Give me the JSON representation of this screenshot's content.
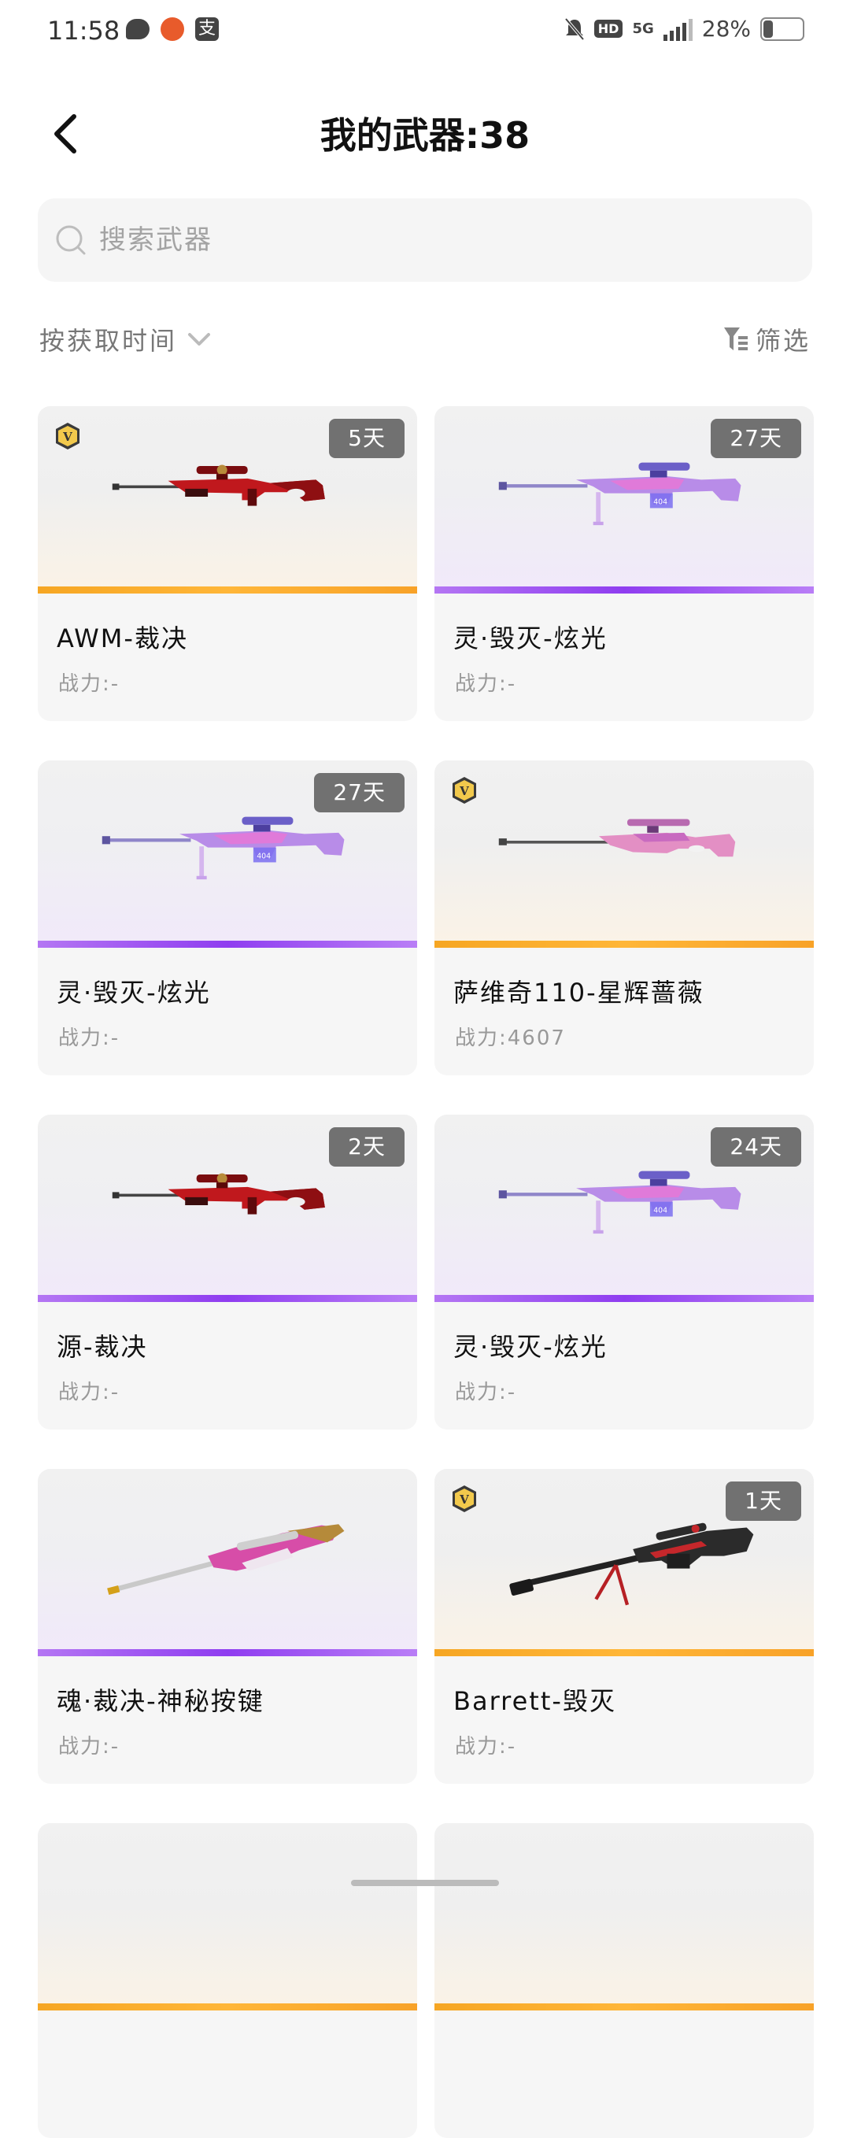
{
  "status_bar": {
    "time": "11:58",
    "zhi_icon": "支",
    "hd": "HD",
    "network": "5G",
    "battery": "28%",
    "battery_level": 0.28
  },
  "header": {
    "title": "我的武器:38",
    "back_icon": "chevron-left-icon"
  },
  "search": {
    "placeholder": "搜索武器",
    "icon": "search-icon"
  },
  "sort": {
    "label": "按获取时间",
    "icon": "chevron-down-icon"
  },
  "filter": {
    "label": "筛选",
    "icon": "filter-icon"
  },
  "colors": {
    "gold_bar": "#f6a623",
    "purple_bar": "#8f3df0",
    "tag_bg": "#5a5a5a"
  },
  "cards": [
    {
      "name": "AWM-裁决",
      "power": "战力:-",
      "days": "5天",
      "vip": true,
      "rarity": "gold",
      "gun": "red-sniper"
    },
    {
      "name": "灵·毁灭-炫光",
      "power": "战力:-",
      "days": "27天",
      "vip": false,
      "rarity": "purple",
      "gun": "purple-barrett"
    },
    {
      "name": "灵·毁灭-炫光",
      "power": "战力:-",
      "days": "27天",
      "vip": false,
      "rarity": "purple",
      "gun": "purple-barrett"
    },
    {
      "name": "萨维奇110-星辉蔷薇",
      "power": "战力:4607",
      "days": "",
      "vip": true,
      "rarity": "gold",
      "gun": "pink-sniper"
    },
    {
      "name": "源-裁决",
      "power": "战力:-",
      "days": "2天",
      "vip": false,
      "rarity": "purple",
      "gun": "red-sniper"
    },
    {
      "name": "灵·毁灭-炫光",
      "power": "战力:-",
      "days": "24天",
      "vip": false,
      "rarity": "purple",
      "gun": "purple-barrett"
    },
    {
      "name": "魂·裁决-神秘按键",
      "power": "战力:-",
      "days": "",
      "vip": false,
      "rarity": "purple",
      "gun": "gold-pink-sniper"
    },
    {
      "name": "Barrett-毁灭",
      "power": "战力:-",
      "days": "1天",
      "vip": true,
      "rarity": "gold",
      "gun": "black-barrett"
    },
    {
      "name": "",
      "power": "",
      "days": "",
      "vip": false,
      "rarity": "gold",
      "gun": "partial"
    },
    {
      "name": "",
      "power": "",
      "days": "",
      "vip": false,
      "rarity": "gold",
      "gun": "partial"
    }
  ]
}
